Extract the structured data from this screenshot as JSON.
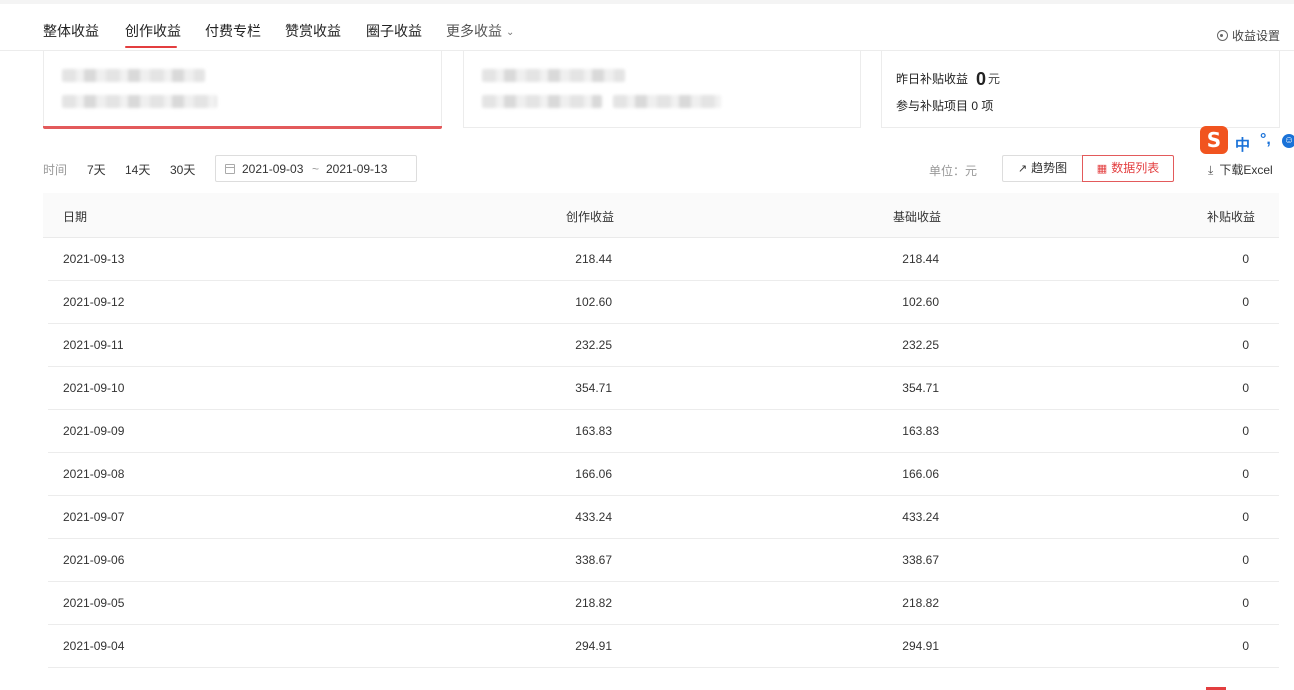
{
  "tabs": [
    {
      "label": "整体收益"
    },
    {
      "label": "创作收益",
      "active": true
    },
    {
      "label": "付费专栏"
    },
    {
      "label": "赞赏收益"
    },
    {
      "label": "圈子收益"
    },
    {
      "label": "更多收益"
    }
  ],
  "settings_label": "收益设置",
  "subsidy": {
    "yesterday_label": "昨日补贴收益",
    "yesterday_value": "0",
    "yesterday_unit": "元",
    "projects_text": "参与补贴项目 0 项"
  },
  "filters": {
    "time_label": "时间",
    "options": [
      "7天",
      "14天",
      "30天"
    ],
    "date_start": "2021-09-03",
    "date_sep": "~",
    "date_end": "2021-09-13",
    "unit_text": "单位：元",
    "trend_label": "趋势图",
    "list_label": "数据列表",
    "download_label": "下载Excel"
  },
  "ime": {
    "zh": "中",
    "punct": "°,"
  },
  "table": {
    "headers": [
      "日期",
      "创作收益",
      "基础收益",
      "补贴收益"
    ],
    "rows": [
      [
        "2021-09-13",
        "218.44",
        "218.44",
        "0"
      ],
      [
        "2021-09-12",
        "102.60",
        "102.60",
        "0"
      ],
      [
        "2021-09-11",
        "232.25",
        "232.25",
        "0"
      ],
      [
        "2021-09-10",
        "354.71",
        "354.71",
        "0"
      ],
      [
        "2021-09-09",
        "163.83",
        "163.83",
        "0"
      ],
      [
        "2021-09-08",
        "166.06",
        "166.06",
        "0"
      ],
      [
        "2021-09-07",
        "433.24",
        "433.24",
        "0"
      ],
      [
        "2021-09-06",
        "338.67",
        "338.67",
        "0"
      ],
      [
        "2021-09-05",
        "218.82",
        "218.82",
        "0"
      ],
      [
        "2021-09-04",
        "294.91",
        "294.91",
        "0"
      ]
    ]
  },
  "colors": {
    "accent": "#e33e3f",
    "ime_brand": "#f1541f",
    "ime_blue": "#1a72d8"
  }
}
